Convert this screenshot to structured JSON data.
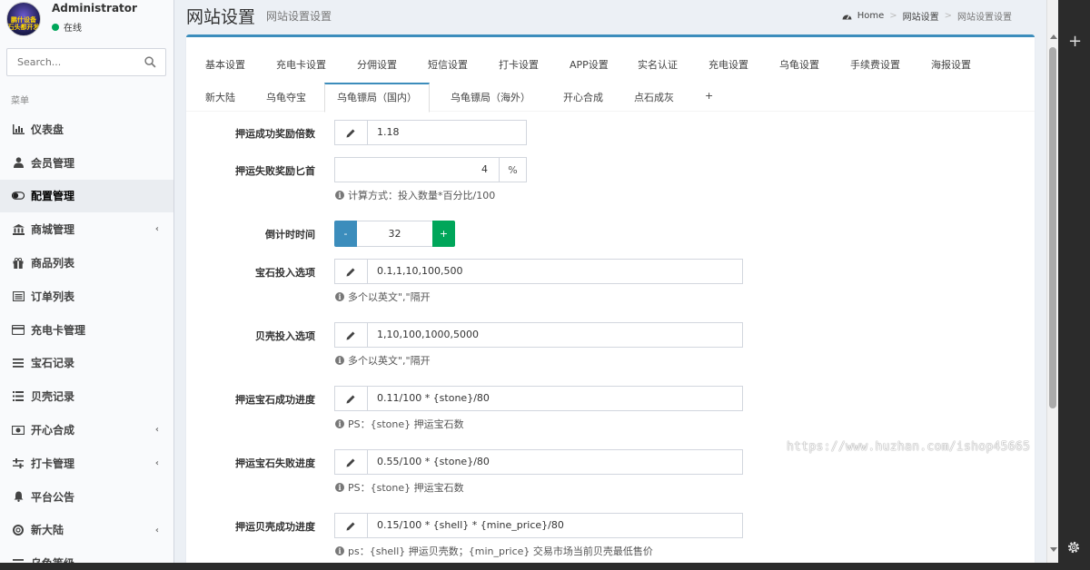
{
  "user": {
    "name": "Administrator",
    "status": "在线",
    "avatar_text": "鹏什设备\n石头都开发"
  },
  "search": {
    "placeholder": "Search..."
  },
  "menu_header": "菜单",
  "menu": [
    {
      "label": "仪表盘",
      "icon": "dashboard-icon",
      "chevron": false,
      "active": false
    },
    {
      "label": "会员管理",
      "icon": "user-icon",
      "chevron": false,
      "active": false
    },
    {
      "label": "配置管理",
      "icon": "toggle-icon",
      "chevron": false,
      "active": true
    },
    {
      "label": "商城管理",
      "icon": "bank-icon",
      "chevron": true,
      "active": false
    },
    {
      "label": "商品列表",
      "icon": "gift-icon",
      "chevron": false,
      "active": false
    },
    {
      "label": "订单列表",
      "icon": "list-alt-icon",
      "chevron": false,
      "active": false
    },
    {
      "label": "充电卡管理",
      "icon": "credit-card-icon",
      "chevron": false,
      "active": false
    },
    {
      "label": "宝石记录",
      "icon": "bars-icon",
      "chevron": false,
      "active": false
    },
    {
      "label": "贝壳记录",
      "icon": "list-icon",
      "chevron": false,
      "active": false
    },
    {
      "label": "开心合成",
      "icon": "money-icon",
      "chevron": true,
      "active": false
    },
    {
      "label": "打卡管理",
      "icon": "sliders-icon",
      "chevron": true,
      "active": false
    },
    {
      "label": "平台公告",
      "icon": "bell-icon",
      "chevron": false,
      "active": false
    },
    {
      "label": "新大陆",
      "icon": "life-ring-icon",
      "chevron": true,
      "active": false
    },
    {
      "label": "乌龟等级",
      "icon": "level-icon",
      "chevron": false,
      "active": false
    }
  ],
  "header": {
    "title": "网站设置",
    "subtitle": "网站设置设置"
  },
  "breadcrumb": {
    "home": "Home",
    "item1": "网站设置",
    "item2": "网站设置设置"
  },
  "tabs_row1": [
    "基本设置",
    "充电卡设置",
    "分佣设置",
    "短信设置",
    "打卡设置",
    "APP设置",
    "实名认证",
    "充电设置",
    "乌龟设置",
    "手续费设置",
    "海报设置"
  ],
  "tabs_row2": [
    "新大陆",
    "乌龟夺宝",
    "乌龟镖局（国内）",
    "乌龟镖局（海外）",
    "开心合成",
    "点石成灰",
    "+"
  ],
  "active_tab": "乌龟镖局（国内）",
  "form": {
    "success_multiplier": {
      "label": "押运成功奖励倍数",
      "value": "1.18"
    },
    "fail_reward": {
      "label": "押运失败奖励匕首",
      "value": "4",
      "suffix": "%",
      "help": "计算方式：投入数量*百分比/100"
    },
    "countdown": {
      "label": "倒计时时间",
      "value": "32",
      "minus": "-",
      "plus": "+"
    },
    "gem_options": {
      "label": "宝石投入选项",
      "value": "0.1,1,10,100,500",
      "help": "多个以英文\",\"隔开"
    },
    "shell_options": {
      "label": "贝壳投入选项",
      "value": "1,10,100,1000,5000",
      "help": "多个以英文\",\"隔开"
    },
    "gem_success_progress": {
      "label": "押运宝石成功进度",
      "value": "0.11/100 * {stone}/80",
      "help": "PS：{stone} 押运宝石数"
    },
    "gem_fail_progress": {
      "label": "押运宝石失败进度",
      "value": "0.55/100 * {stone}/80",
      "help": "PS：{stone} 押运宝石数"
    },
    "shell_success_progress": {
      "label": "押运贝壳成功进度",
      "value": "0.15/100 * {shell} * {mine_price}/80",
      "help": "ps：{shell} 押运贝壳数；{min_price} 交易市场当前贝壳最低售价"
    }
  },
  "watermark": "https://www.huzhan.com/ishop45665",
  "colors": {
    "primary": "#3c8dbc",
    "success": "#00a65a",
    "status_online": "#00a65a"
  }
}
